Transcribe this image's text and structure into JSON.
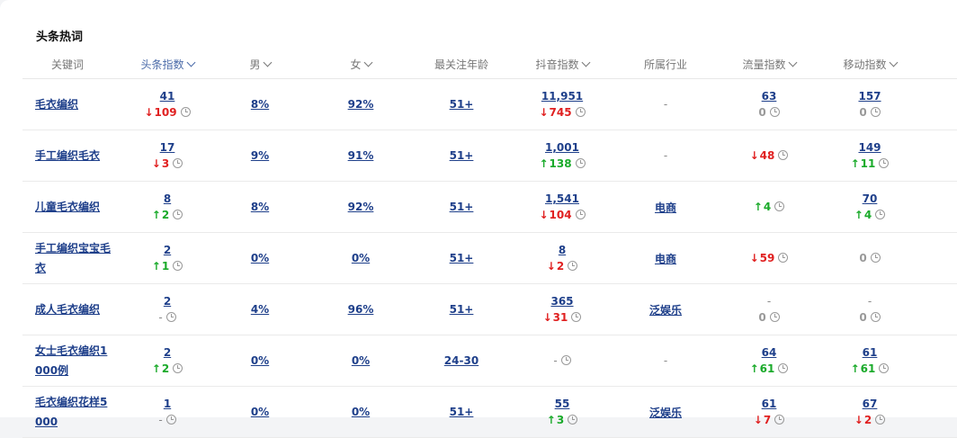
{
  "section_title": "头条热词",
  "columns": {
    "keyword": "关键词",
    "toutiao_index": "头条指数",
    "male": "男",
    "female": "女",
    "age": "最关注年龄",
    "douyin_index": "抖音指数",
    "industry": "所属行业",
    "traffic": "流量指数",
    "mobile": "移动指数"
  },
  "rows": [
    {
      "keyword": "毛衣编织",
      "toutiao": {
        "value": "41",
        "dir": "down",
        "change": "109"
      },
      "male": "8%",
      "female": "92%",
      "age": "51+",
      "douyin": {
        "value": "11,951",
        "dir": "down",
        "change": "745"
      },
      "industry": "-",
      "industry_link": false,
      "traffic": {
        "value": "63",
        "dir": "zero",
        "change": "0"
      },
      "mobile": {
        "value": "157",
        "dir": "zero",
        "change": "0"
      }
    },
    {
      "keyword": "手工编织毛衣",
      "toutiao": {
        "value": "17",
        "dir": "down",
        "change": "3"
      },
      "male": "9%",
      "female": "91%",
      "age": "51+",
      "douyin": {
        "value": "1,001",
        "dir": "up",
        "change": "138"
      },
      "industry": "-",
      "industry_link": false,
      "traffic": {
        "value": "",
        "dir": "down",
        "change": "48"
      },
      "mobile": {
        "value": "149",
        "dir": "up",
        "change": "11"
      }
    },
    {
      "keyword": "儿童毛衣编织",
      "toutiao": {
        "value": "8",
        "dir": "up",
        "change": "2"
      },
      "male": "8%",
      "female": "92%",
      "age": "51+",
      "douyin": {
        "value": "1,541",
        "dir": "down",
        "change": "104"
      },
      "industry": "电商",
      "industry_link": true,
      "traffic": {
        "value": "",
        "dir": "up",
        "change": "4"
      },
      "mobile": {
        "value": "70",
        "dir": "up",
        "change": "4"
      }
    },
    {
      "keyword": "手工编织宝宝毛衣",
      "toutiao": {
        "value": "2",
        "dir": "up",
        "change": "1"
      },
      "male": "0%",
      "female": "0%",
      "age": "51+",
      "douyin": {
        "value": "8",
        "dir": "down",
        "change": "2"
      },
      "industry": "电商",
      "industry_link": true,
      "traffic": {
        "value": "",
        "dir": "down",
        "change": "59"
      },
      "mobile": {
        "value": "",
        "dir": "zero",
        "change": "0"
      }
    },
    {
      "keyword": "成人毛衣编织",
      "toutiao": {
        "value": "2",
        "dir": "none",
        "change": "-"
      },
      "male": "4%",
      "female": "96%",
      "age": "51+",
      "douyin": {
        "value": "365",
        "dir": "down",
        "change": "31"
      },
      "industry": "泛娱乐",
      "industry_link": true,
      "traffic": {
        "value": "-",
        "dir": "zero",
        "change": "0"
      },
      "mobile": {
        "value": "-",
        "dir": "zero",
        "change": "0"
      }
    },
    {
      "keyword": "女士毛衣编织1000例",
      "toutiao": {
        "value": "2",
        "dir": "up",
        "change": "2"
      },
      "male": "0%",
      "female": "0%",
      "age": "24-30",
      "douyin": {
        "value": "",
        "dir": "none",
        "change": "-"
      },
      "industry": "-",
      "industry_link": false,
      "traffic": {
        "value": "64",
        "dir": "up",
        "change": "61"
      },
      "mobile": {
        "value": "61",
        "dir": "up",
        "change": "61"
      }
    },
    {
      "keyword": "毛衣编织花样5000",
      "toutiao": {
        "value": "1",
        "dir": "none",
        "change": "-"
      },
      "male": "0%",
      "female": "0%",
      "age": "51+",
      "douyin": {
        "value": "55",
        "dir": "up",
        "change": "3"
      },
      "industry": "泛娱乐",
      "industry_link": true,
      "traffic": {
        "value": "61",
        "dir": "down",
        "change": "7"
      },
      "mobile": {
        "value": "67",
        "dir": "down",
        "change": "2"
      }
    }
  ],
  "colors": {
    "down": "#e02020",
    "up": "#1aaa2a",
    "link": "#1e3f8a",
    "header_sort": "#4a6aa8"
  }
}
